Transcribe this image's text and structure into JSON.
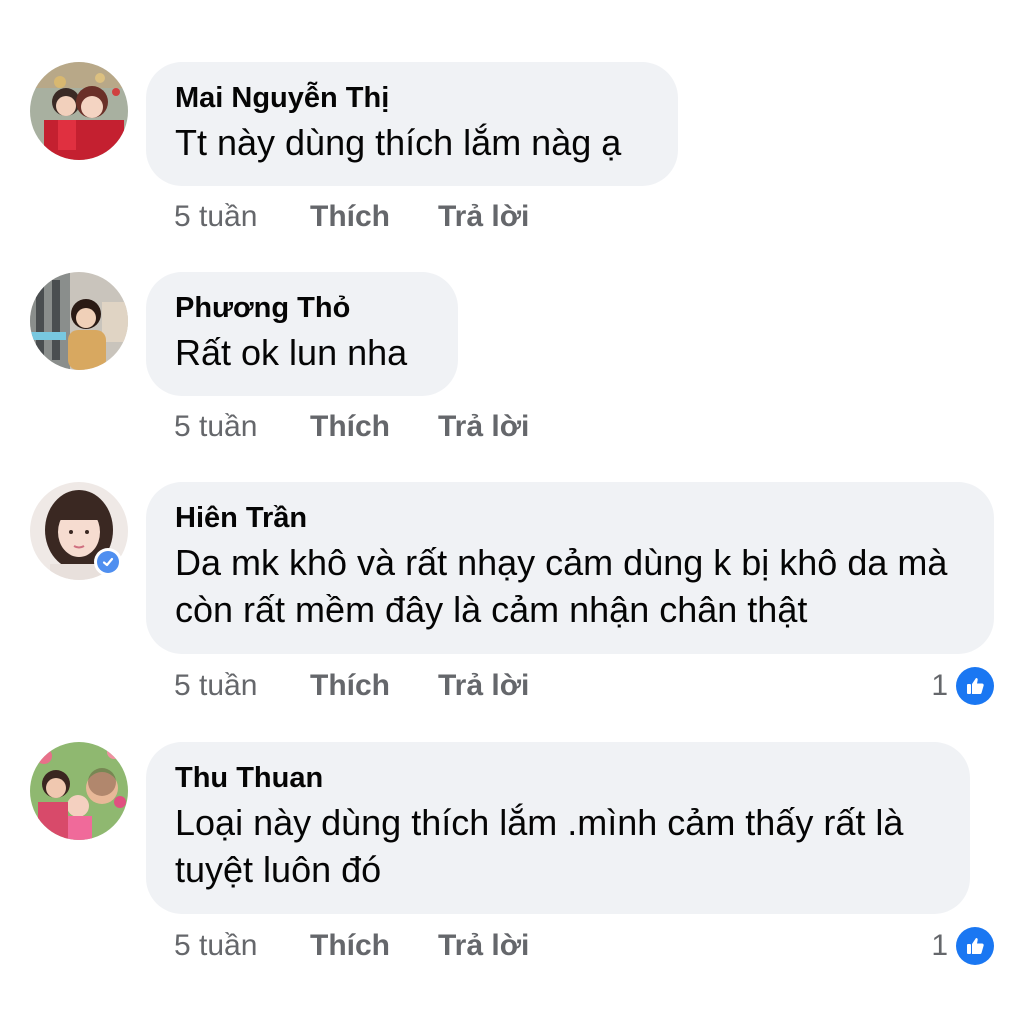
{
  "actions": {
    "like_label": "Thích",
    "reply_label": "Trả lời"
  },
  "colors": {
    "bubble_bg": "#f0f2f5",
    "meta_text": "#65676b",
    "like_blue": "#1a77f2"
  },
  "comments": [
    {
      "name": "Mai Nguyễn Thị",
      "text": "Tt này dùng thích lắm nàg ạ",
      "time": "5 tuần",
      "reactions": null,
      "verified": false
    },
    {
      "name": "Phương Thỏ",
      "text": "Rất ok lun nha",
      "time": "5 tuần",
      "reactions": null,
      "verified": false
    },
    {
      "name": "Hiên Trần",
      "text": "Da mk khô và rất nhạy cảm dùng k bị khô da mà còn rất mềm đây là cảm nhận chân thật",
      "time": "5 tuần",
      "reactions": "1",
      "verified": true
    },
    {
      "name": "Thu Thuan",
      "text": "Loại này dùng thích lắm .mình cảm thấy rất là tuyệt luôn đó",
      "time": "5 tuần",
      "reactions": "1",
      "verified": false
    }
  ]
}
